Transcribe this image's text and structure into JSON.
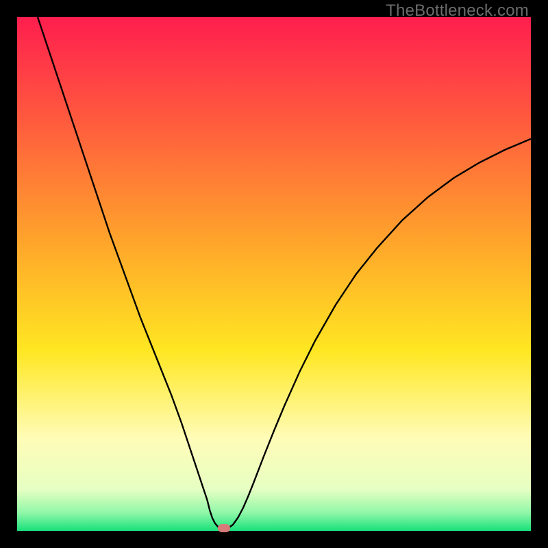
{
  "watermark": "TheBottleneck.com",
  "chart_data": {
    "type": "line",
    "title": "",
    "xlabel": "",
    "ylabel": "",
    "xlim": [
      0,
      100
    ],
    "ylim": [
      0,
      100
    ],
    "grid": false,
    "background_gradient": {
      "stops": [
        {
          "pos": 0.0,
          "color": "#ff1e4e"
        },
        {
          "pos": 0.2,
          "color": "#ff5a3e"
        },
        {
          "pos": 0.45,
          "color": "#ffa92a"
        },
        {
          "pos": 0.65,
          "color": "#ffe722"
        },
        {
          "pos": 0.82,
          "color": "#fffcb8"
        },
        {
          "pos": 0.92,
          "color": "#e6ffc2"
        },
        {
          "pos": 0.965,
          "color": "#8ff7a8"
        },
        {
          "pos": 1.0,
          "color": "#18e07a"
        }
      ]
    },
    "series": [
      {
        "name": "bottleneck-curve",
        "color": "#000000",
        "x": [
          4,
          6,
          8,
          10,
          12,
          14,
          16,
          18,
          20,
          22,
          24,
          26,
          28,
          30,
          32,
          33,
          34,
          35,
          36,
          37,
          37.5,
          38,
          38.5,
          39,
          39.3,
          39.5,
          40,
          41,
          42,
          43,
          44,
          45,
          46,
          48,
          50,
          52,
          55,
          58,
          62,
          66,
          70,
          75,
          80,
          85,
          90,
          95,
          100
        ],
        "y": [
          100,
          94,
          88,
          82,
          76,
          70,
          64,
          58,
          52.5,
          47,
          41.5,
          36.5,
          31.5,
          26.5,
          21,
          18,
          15,
          12,
          9,
          6,
          4,
          2.5,
          1.5,
          0.9,
          0.6,
          0.5,
          0.5,
          0.48,
          1.2,
          2.6,
          4.5,
          6.8,
          9.3,
          14.5,
          19.5,
          24.3,
          31,
          37,
          44,
          50,
          55,
          60.5,
          65,
          68.7,
          71.7,
          74.2,
          76.3
        ]
      }
    ],
    "marker": {
      "name": "optimum-point",
      "x": 40.2,
      "y": 0.5,
      "color": "#d97a7a"
    }
  }
}
